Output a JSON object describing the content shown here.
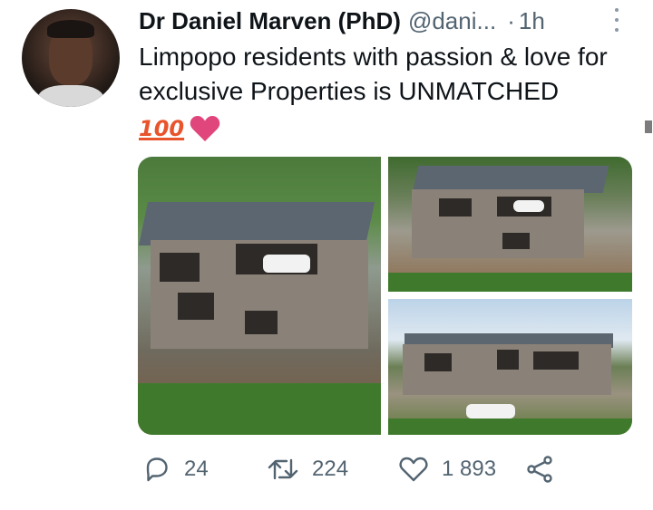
{
  "tweet": {
    "author_name": "Dr Daniel Marven (PhD)",
    "handle": "@dani...",
    "separator": "·",
    "time": "1h",
    "text": "Limpopo residents with passion & love for exclusive Properties is UNMATCHED",
    "emoji_hundred": "100",
    "icons": {
      "avatar": "profile-photo",
      "more": "more-vertical-icon",
      "heart_emoji": "heart-emoji-icon"
    }
  },
  "actions": {
    "reply_count": "24",
    "retweet_count": "224",
    "like_count": "1 893",
    "icons": [
      "reply-icon",
      "retweet-icon",
      "like-icon",
      "share-icon"
    ]
  },
  "colors": {
    "text_primary": "#0f1419",
    "text_secondary": "#536471",
    "heart": "#e0457b",
    "hundred": "#e8542c"
  }
}
